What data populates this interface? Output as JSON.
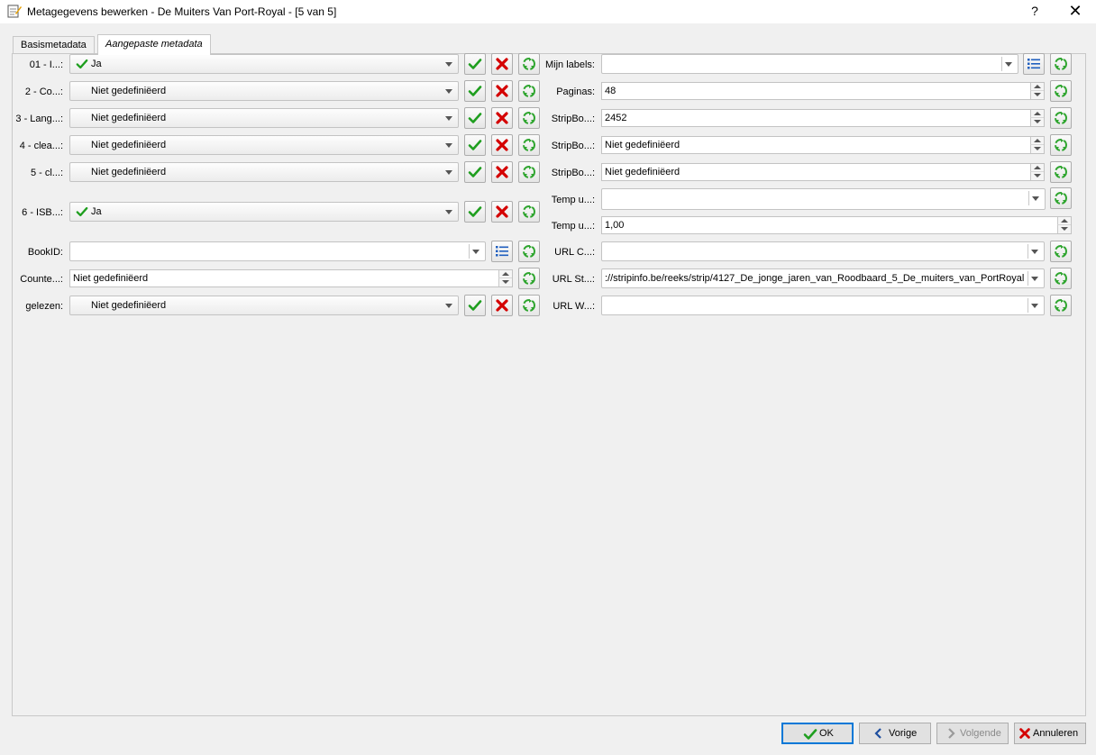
{
  "window": {
    "title": "Metagegevens bewerken - De Muiters Van Port-Royal -  [5 van 5]",
    "help": "?",
    "close": "✕"
  },
  "tabs": [
    {
      "label": "Basismetadata",
      "active": false
    },
    {
      "label": "Aangepaste metadata",
      "active": true
    }
  ],
  "left_fields": [
    {
      "label": "01 - I...:",
      "value": "Ja",
      "checked": true
    },
    {
      "label": "2 - Co...:",
      "value": "Niet gedefiniëerd"
    },
    {
      "label": "3 - Lang...:",
      "value": "Niet gedefiniëerd"
    },
    {
      "label": "4 - clea...:",
      "value": "Niet gedefiniëerd"
    },
    {
      "label": "5 - cl...:",
      "value": "Niet gedefiniëerd"
    },
    {
      "label": "6 - ISB...:",
      "value": "Ja",
      "checked": true
    },
    {
      "label": "BookID:",
      "value": ""
    },
    {
      "label": "Counte...:",
      "value": "Niet gedefiniëerd"
    },
    {
      "label": "gelezen:",
      "value": "Niet gedefiniëerd"
    }
  ],
  "right_fields": [
    {
      "label": "Mijn labels:",
      "value": ""
    },
    {
      "label": "Paginas:",
      "value": "48"
    },
    {
      "label": "StripBo...:",
      "value": "2452"
    },
    {
      "label": "StripBo...:",
      "value": "Niet gedefiniëerd"
    },
    {
      "label": "StripBo...:",
      "value": "Niet gedefiniëerd"
    },
    {
      "label": "Temp u...:",
      "value": ""
    },
    {
      "label": "Temp u...:",
      "value": "1,00"
    },
    {
      "label": "URL C...:",
      "value": ""
    },
    {
      "label": "URL St...:",
      "value": "://stripinfo.be/reeks/strip/4127_De_jonge_jaren_van_Roodbaard_5_De_muiters_van_PortRoyal"
    },
    {
      "label": "URL W...:",
      "value": ""
    }
  ],
  "buttons": {
    "ok": "OK",
    "previous": "Vorige",
    "next": "Volgende",
    "cancel": "Annuleren"
  },
  "colors": {
    "check_green": "#1e9e1e",
    "cross_red": "#d40000",
    "recycle_green": "#2fa52f",
    "list_blue": "#1f5fbf"
  }
}
